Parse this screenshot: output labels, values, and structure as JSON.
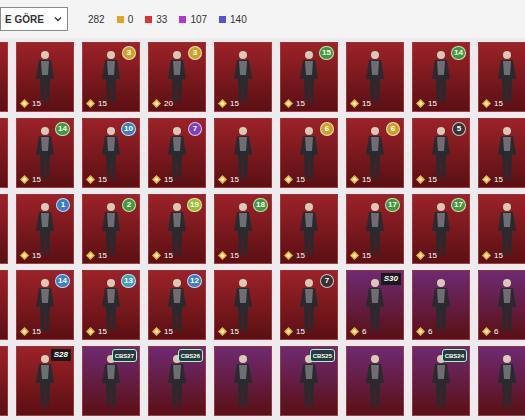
{
  "toolbar": {
    "sort": {
      "label": "E GÖRE"
    },
    "total": "282",
    "counts": [
      {
        "value": "0",
        "color": "#e8a21b"
      },
      {
        "value": "33",
        "color": "#e0312f"
      },
      {
        "value": "107",
        "color": "#b336d6"
      },
      {
        "value": "140",
        "color": "#5a4ee0"
      }
    ]
  },
  "inventory": {
    "rows": [
      {
        "cards": [
          {
            "color": "#9b2228"
          },
          {
            "color": "#9b2228",
            "cost": "15"
          },
          {
            "color": "#9b2228",
            "cost": "15",
            "badge": "3",
            "badge_kind": "circle",
            "badge_color": "#c9a227"
          },
          {
            "color": "#9b2228",
            "cost": "20",
            "badge": "3",
            "badge_kind": "circle",
            "badge_color": "#c9a227"
          },
          {
            "color": "#9b2228",
            "cost": "15"
          },
          {
            "color": "#9b2228",
            "cost": "15",
            "badge": "15",
            "badge_kind": "circle",
            "badge_color": "#3f9a3a"
          },
          {
            "color": "#9b2228",
            "cost": "15"
          },
          {
            "color": "#9b2228",
            "cost": "15",
            "badge": "14",
            "badge_kind": "circle",
            "badge_color": "#3f9a3a"
          },
          {
            "color": "#9b2228",
            "cost": "15"
          }
        ]
      },
      {
        "cards": [
          {
            "color": "#9b2228"
          },
          {
            "color": "#9b2228",
            "cost": "15",
            "badge": "14",
            "badge_kind": "circle",
            "badge_color": "#3f9a3a"
          },
          {
            "color": "#9b2228",
            "cost": "15",
            "badge": "10",
            "badge_kind": "circle",
            "badge_color": "#3a7fc4"
          },
          {
            "color": "#9b2228",
            "cost": "15",
            "badge": "7",
            "badge_kind": "circle",
            "badge_color": "#7b3fc4"
          },
          {
            "color": "#9b2228",
            "cost": "15"
          },
          {
            "color": "#9b2228",
            "cost": "15",
            "badge": "6",
            "badge_kind": "circle",
            "badge_color": "#c9a227"
          },
          {
            "color": "#9b2228",
            "cost": "15",
            "badge": "6",
            "badge_kind": "circle",
            "badge_color": "#c9a227"
          },
          {
            "color": "#9b2228",
            "cost": "15",
            "badge": "5",
            "badge_kind": "circle",
            "badge_color": "#333333"
          },
          {
            "color": "#9b2228",
            "cost": "15"
          }
        ]
      },
      {
        "cards": [
          {
            "color": "#9b2228"
          },
          {
            "color": "#9b2228",
            "cost": "15",
            "badge": "1",
            "badge_kind": "circle",
            "badge_color": "#3a7fc4"
          },
          {
            "color": "#9b2228",
            "cost": "15",
            "badge": "2",
            "badge_kind": "circle",
            "badge_color": "#3f9a3a"
          },
          {
            "color": "#9b2228",
            "cost": "15",
            "badge": "19",
            "badge_kind": "circle",
            "badge_color": "#9bbf2a"
          },
          {
            "color": "#9b2228",
            "cost": "15",
            "badge": "18",
            "badge_kind": "circle",
            "badge_color": "#3f9a3a"
          },
          {
            "color": "#9b2228",
            "cost": "15"
          },
          {
            "color": "#9b2228",
            "cost": "15",
            "badge": "17",
            "badge_kind": "circle",
            "badge_color": "#3f9a3a"
          },
          {
            "color": "#9b2228",
            "cost": "15",
            "badge": "17",
            "badge_kind": "circle",
            "badge_color": "#3f9a3a"
          },
          {
            "color": "#9b2228",
            "cost": "15"
          }
        ]
      },
      {
        "cards": [
          {
            "color": "#9b2228"
          },
          {
            "color": "#9b2228",
            "cost": "15",
            "badge": "14",
            "badge_kind": "circle",
            "badge_color": "#3a7fc4"
          },
          {
            "color": "#9b2228",
            "cost": "15",
            "badge": "13",
            "badge_kind": "circle",
            "badge_color": "#3a9fc4"
          },
          {
            "color": "#9b2228",
            "cost": "15",
            "badge": "12",
            "badge_kind": "circle",
            "badge_color": "#3a7fc4"
          },
          {
            "color": "#9b2228",
            "cost": "15"
          },
          {
            "color": "#9b2228",
            "cost": "15",
            "badge": "7",
            "badge_kind": "circle",
            "badge_color": "#333333"
          },
          {
            "color": "#6e2a72",
            "cost": "6",
            "badge": "S30",
            "badge_kind": "label",
            "badge_color": "#1a1a1a"
          },
          {
            "color": "#6e2a72",
            "cost": "6"
          },
          {
            "color": "#6e2a72",
            "cost": "6"
          }
        ]
      },
      {
        "cards": [
          {
            "color": "#9b2228"
          },
          {
            "color": "#9b2228",
            "badge": "S28",
            "badge_kind": "label",
            "badge_color": "#1a1a1a"
          },
          {
            "color": "#6e2a72",
            "badge": "CBS27",
            "badge_kind": "hex",
            "badge_color": "#2a3a3a"
          },
          {
            "color": "#6e2a72",
            "badge": "CBS26",
            "badge_kind": "hex",
            "badge_color": "#2a3a3a"
          },
          {
            "color": "#6e2a72"
          },
          {
            "color": "#6e2a72",
            "badge": "CBS25",
            "badge_kind": "hex",
            "badge_color": "#2a3a3a"
          },
          {
            "color": "#6e2a72"
          },
          {
            "color": "#6e2a72",
            "badge": "CBS24",
            "badge_kind": "hex",
            "badge_color": "#2a3a3a"
          },
          {
            "color": "#6e2a72"
          }
        ]
      }
    ]
  }
}
